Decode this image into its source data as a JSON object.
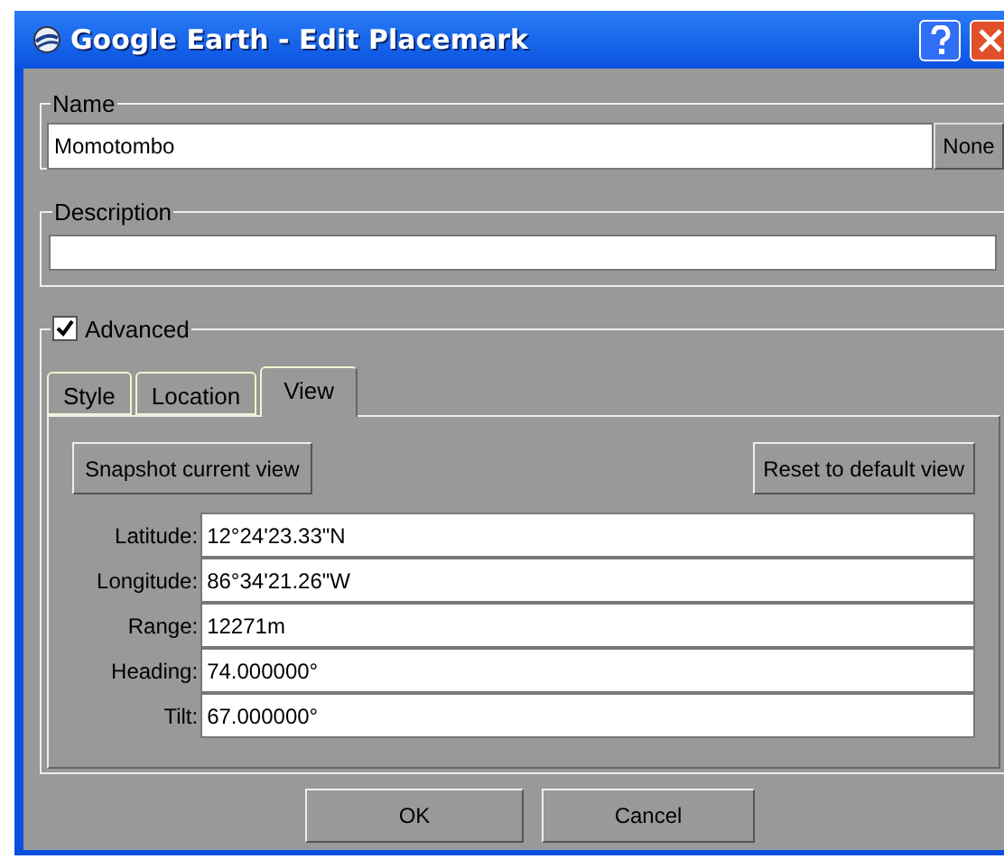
{
  "window": {
    "title": "Google Earth - Edit Placemark"
  },
  "name": {
    "legend": "Name",
    "value": "Momotombo",
    "button": "None"
  },
  "description": {
    "legend": "Description"
  },
  "advanced": {
    "label": "Advanced",
    "checked": true
  },
  "tabs": [
    {
      "label": "Style",
      "selected": false
    },
    {
      "label": "Location",
      "selected": false
    },
    {
      "label": "View",
      "selected": true
    }
  ],
  "view": {
    "snapshot_button": "Snapshot current view",
    "reset_button": "Reset to default view",
    "fields": [
      {
        "label": "Latitude:",
        "value": "12°24'23.33\"N"
      },
      {
        "label": "Longitude:",
        "value": "86°34'21.26\"W"
      },
      {
        "label": "Range:",
        "value": "12271m"
      },
      {
        "label": "Heading:",
        "value": "74.000000°"
      },
      {
        "label": "Tilt:",
        "value": "67.000000°"
      }
    ]
  },
  "buttons": [
    {
      "label": "OK"
    },
    {
      "label": "Cancel"
    }
  ]
}
